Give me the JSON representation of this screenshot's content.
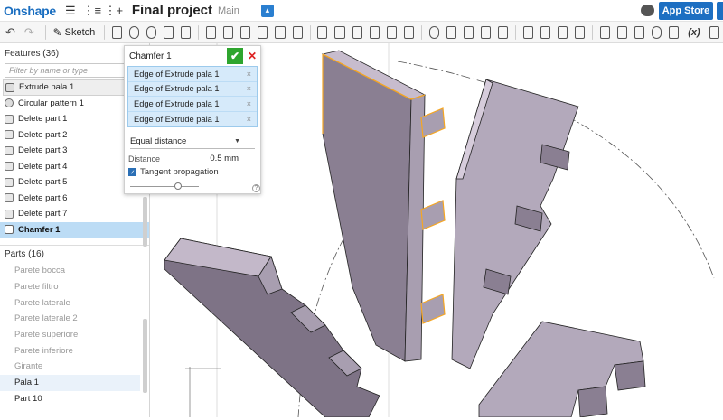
{
  "app": {
    "logo": "Onshape",
    "doc_title": "Final project",
    "branch": "Main",
    "app_store_label": "App Store"
  },
  "toolbar": {
    "sketch_label": "Sketch",
    "fx_label": "(x)"
  },
  "features": {
    "header": "Features (36)",
    "filter_placeholder": "Filter by name or type",
    "items": [
      {
        "label": "Extrude pala 1",
        "icon": "extrude-icon"
      },
      {
        "label": "Circular pattern 1",
        "icon": "circular-pattern-icon"
      },
      {
        "label": "Delete part 1",
        "icon": "delete-part-icon"
      },
      {
        "label": "Delete part 2",
        "icon": "delete-part-icon"
      },
      {
        "label": "Delete part 3",
        "icon": "delete-part-icon"
      },
      {
        "label": "Delete part 4",
        "icon": "delete-part-icon"
      },
      {
        "label": "Delete part 5",
        "icon": "delete-part-icon"
      },
      {
        "label": "Delete part 6",
        "icon": "delete-part-icon"
      },
      {
        "label": "Delete part 7",
        "icon": "delete-part-icon"
      },
      {
        "label": "Chamfer 1",
        "icon": "chamfer-icon"
      }
    ]
  },
  "parts": {
    "header": "Parts (16)",
    "items": [
      "Parete bocca",
      "Parete filtro",
      "Parete laterale",
      "Parete laterale 2",
      "Parete superiore",
      "Parete inferiore",
      "Girante",
      "Pala 1",
      "Part 10"
    ]
  },
  "dialog": {
    "title": "Chamfer 1",
    "edges": [
      "Edge of Extrude pala 1",
      "Edge of Extrude pala 1",
      "Edge of Extrude pala 1",
      "Edge of Extrude pala 1"
    ],
    "edge_remove": "×",
    "type_value": "Equal distance",
    "distance_label": "Distance",
    "distance_value": "0.5 mm",
    "tangent_label": "Tangent propagation",
    "slider_level": 0.7,
    "help": "?"
  },
  "colors": {
    "accent": "#1d6fc2",
    "ok": "#2ea52e",
    "selection": "#bcdcf5",
    "part_fill": "#9a8fa3",
    "highlight_edge": "#f5a623"
  }
}
